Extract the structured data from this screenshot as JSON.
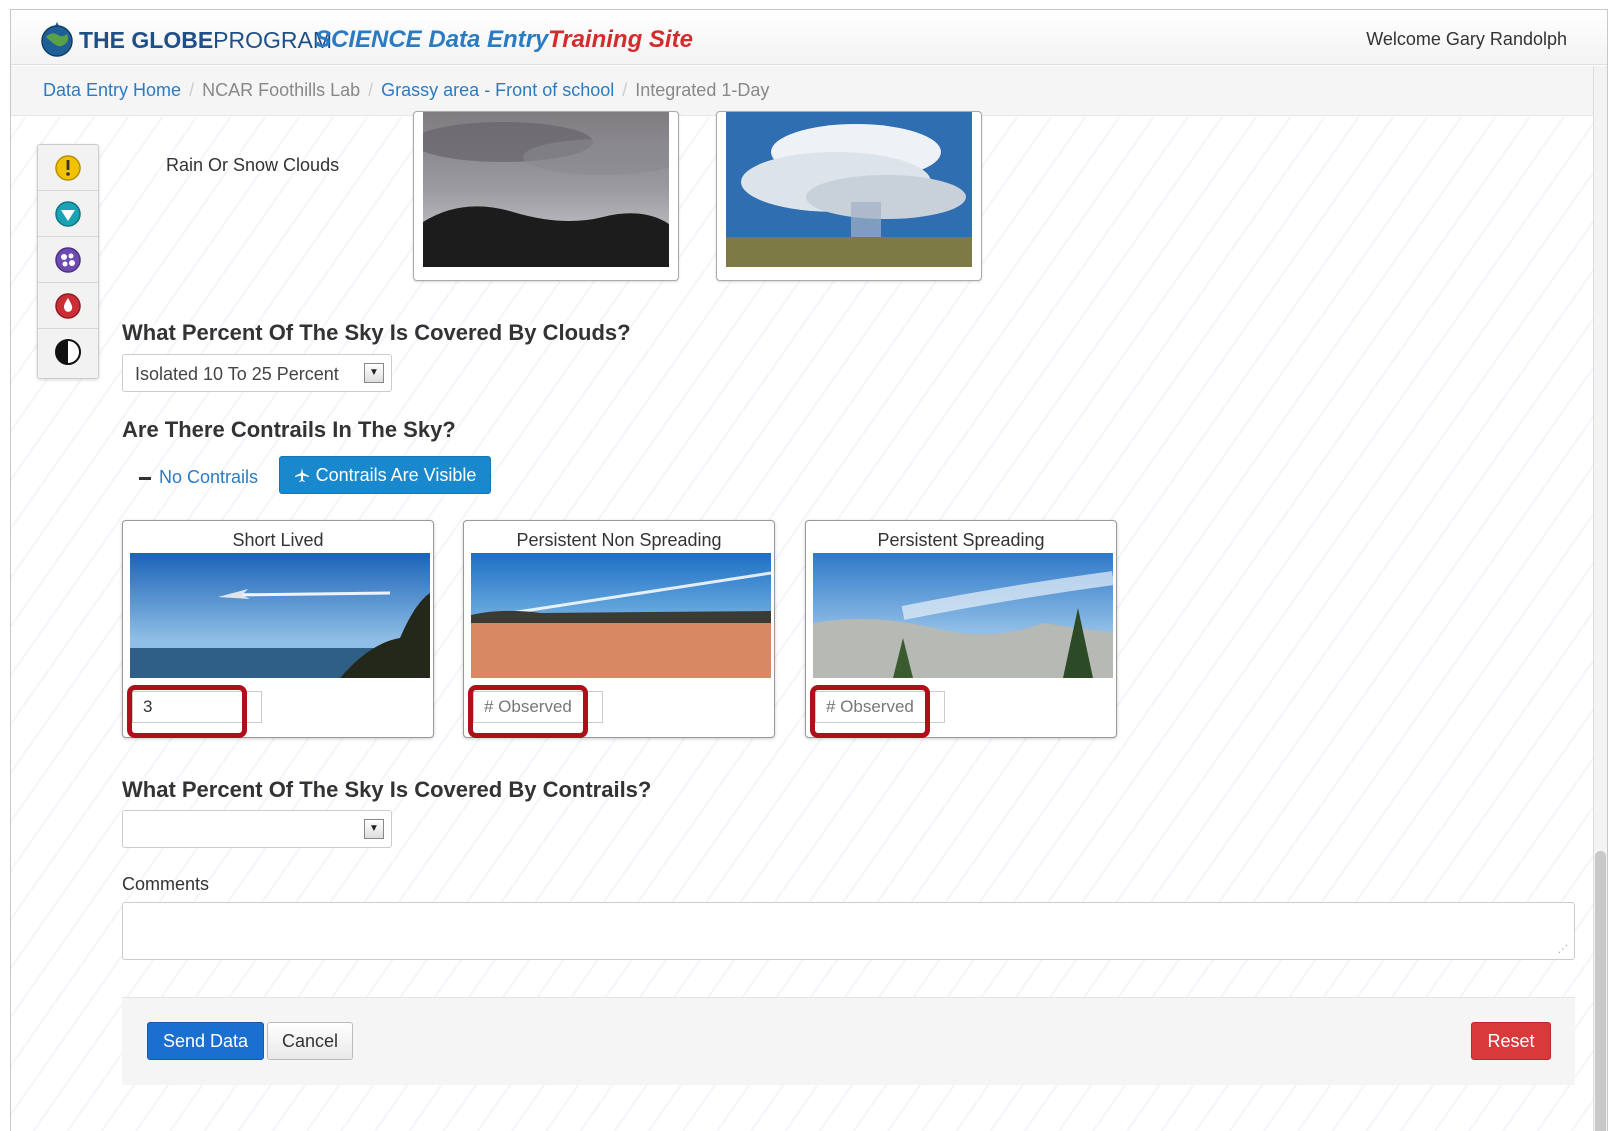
{
  "header": {
    "logo_text_bold": "THE GLOBE",
    "logo_text_rest": "PROGRAM",
    "title": "SCIENCE Data Entry",
    "subtitle": "Training Site",
    "welcome": "Welcome Gary Randolph"
  },
  "breadcrumb": {
    "items": [
      "Data Entry Home",
      "NCAR Foothills Lab",
      "Grassy area - Front of school",
      "Integrated 1-Day"
    ]
  },
  "toolbar_icons": [
    "warning-icon",
    "pin-icon",
    "cloud-type-icon",
    "drop-icon",
    "contrast-icon"
  ],
  "clouds": {
    "row_label": "Rain Or Snow Clouds"
  },
  "sky_cover": {
    "question": "What Percent Of The Sky Is Covered By Clouds?",
    "selected": "Isolated 10 To 25 Percent"
  },
  "contrails": {
    "question": "Are There Contrails In The Sky?",
    "no_label": "No Contrails",
    "yes_label": "Contrails Are Visible",
    "cards": [
      {
        "title": "Short Lived",
        "value": "3",
        "placeholder": "# Observed"
      },
      {
        "title": "Persistent Non Spreading",
        "value": "",
        "placeholder": "# Observed"
      },
      {
        "title": "Persistent Spreading",
        "value": "",
        "placeholder": "# Observed"
      }
    ]
  },
  "contrail_cover": {
    "question": "What Percent Of The Sky Is Covered By Contrails?",
    "selected": ""
  },
  "comments": {
    "label": "Comments",
    "value": ""
  },
  "actions": {
    "send": "Send Data",
    "cancel": "Cancel",
    "reset": "Reset"
  },
  "colors": {
    "primary": "#1a88cc",
    "brand_blue": "#2a7bc2",
    "brand_red": "#d42c2c",
    "highlight": "#b00f1a",
    "danger": "#d9393a"
  }
}
